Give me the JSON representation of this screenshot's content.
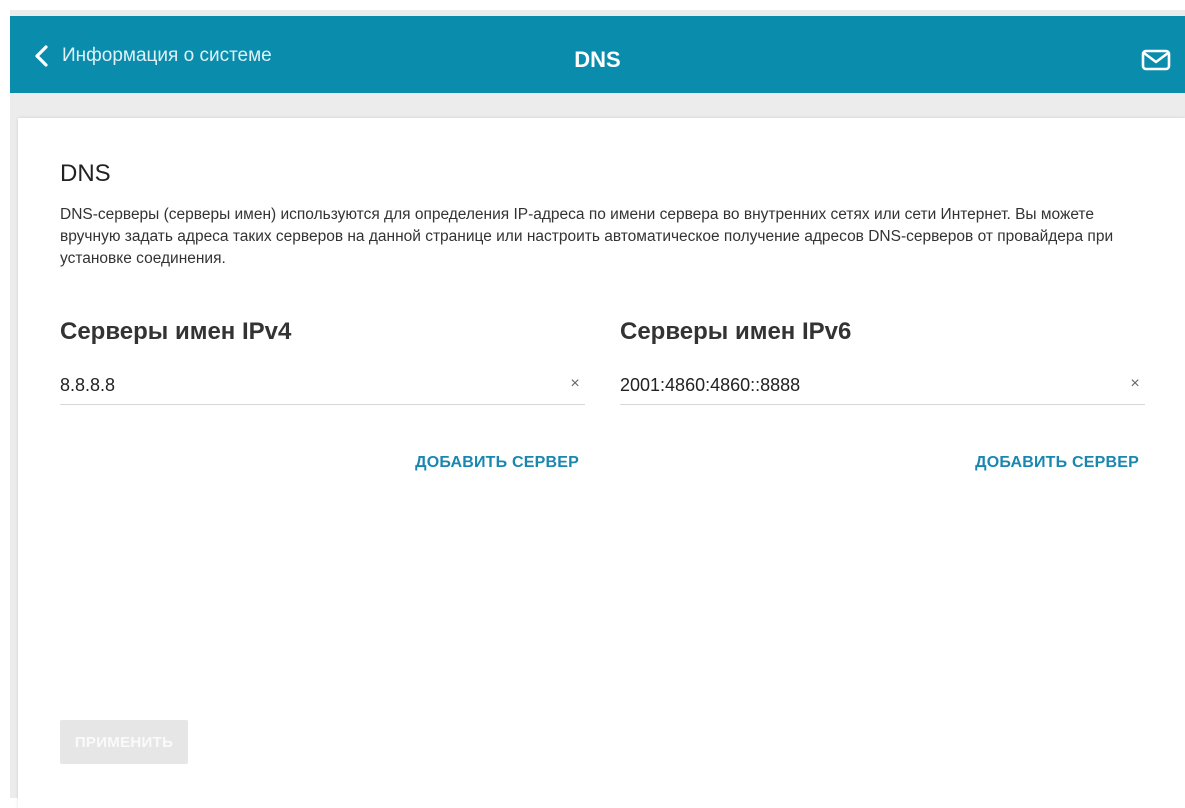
{
  "header": {
    "back_label": "Информация о системе",
    "title": "DNS",
    "bg_color": "#0a8cad",
    "back_icon": "chevron-left-icon",
    "mail_icon": "mail-icon"
  },
  "section": {
    "title": "DNS",
    "description": "DNS-серверы (серверы имен) используются для определения IP-адреса по имени сервера во внутренних сетях или сети Интернет. Вы можете вручную задать адреса таких серверов на данной странице или настроить автоматическое получение адресов DNS-серверов от провайдера при установке соединения."
  },
  "ipv4": {
    "title": "Серверы имен IPv4",
    "value": "8.8.8.8",
    "clear_icon": "×",
    "add_label": "ДОБАВИТЬ СЕРВЕР"
  },
  "ipv6": {
    "title": "Серверы имен IPv6",
    "value": "2001:4860:4860::8888",
    "clear_icon": "×",
    "add_label": "ДОБАВИТЬ СЕРВЕР"
  },
  "apply_label": "ПРИМЕНИТЬ",
  "accent_color": "#1a87b0"
}
